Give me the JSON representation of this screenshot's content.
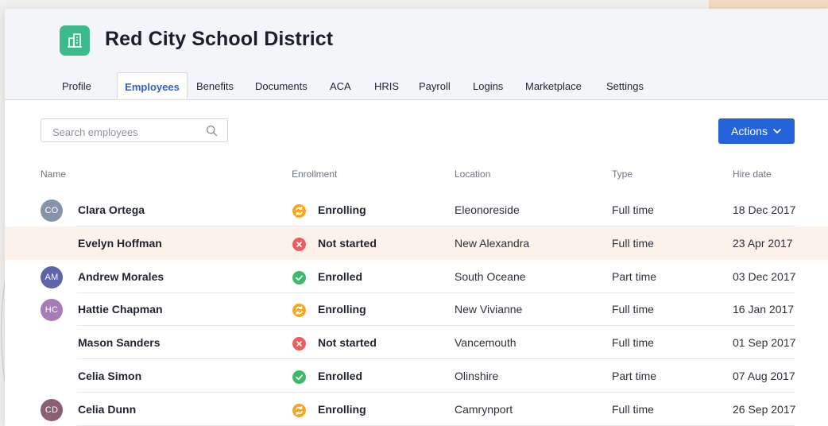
{
  "org": {
    "name": "Red City School District"
  },
  "tabs": [
    {
      "label": "Profile",
      "active": false
    },
    {
      "label": "Employees",
      "active": true
    },
    {
      "label": "Benefits",
      "active": false
    },
    {
      "label": "Documents",
      "active": false
    },
    {
      "label": "ACA",
      "active": false
    },
    {
      "label": "HRIS",
      "active": false
    },
    {
      "label": "Payroll",
      "active": false
    },
    {
      "label": "Logins",
      "active": false
    },
    {
      "label": "Marketplace",
      "active": false
    },
    {
      "label": "Settings",
      "active": false
    }
  ],
  "search": {
    "placeholder": "Search employees",
    "value": ""
  },
  "actions_button": {
    "label": "Actions"
  },
  "table": {
    "columns": [
      "Name",
      "Enrollment",
      "Location",
      "Type",
      "Hire date"
    ],
    "rows": [
      {
        "initials": "CO",
        "avatar_color": "#8594aa",
        "name": "Clara Ortega",
        "status": "Enrolling",
        "status_kind": "enrolling",
        "location": "Eleonoreside",
        "type": "Full time",
        "hire_date": "18 Dec 2017",
        "highlight": false
      },
      {
        "initials": "",
        "avatar_color": "",
        "name": "Evelyn Hoffman",
        "status": "Not started",
        "status_kind": "not-started",
        "location": "New Alexandra",
        "type": "Full time",
        "hire_date": "23 Apr 2017",
        "highlight": true
      },
      {
        "initials": "AM",
        "avatar_color": "#5e64a8",
        "name": "Andrew Morales",
        "status": "Enrolled",
        "status_kind": "enrolled",
        "location": "South Oceane",
        "type": "Part time",
        "hire_date": "03 Dec 2017",
        "highlight": false
      },
      {
        "initials": "HC",
        "avatar_color": "#a57cb6",
        "name": "Hattie Chapman",
        "status": "Enrolling",
        "status_kind": "enrolling",
        "location": "New Vivianne",
        "type": "Full time",
        "hire_date": "16 Jan 2017",
        "highlight": false
      },
      {
        "initials": "",
        "avatar_color": "",
        "name": "Mason Sanders",
        "status": "Not started",
        "status_kind": "not-started",
        "location": "Vancemouth",
        "type": "Full time",
        "hire_date": "01 Sep 2017",
        "highlight": false
      },
      {
        "initials": "",
        "avatar_color": "",
        "name": "Celia Simon",
        "status": "Enrolled",
        "status_kind": "enrolled",
        "location": "Olinshire",
        "type": "Part time",
        "hire_date": "07 Aug 2017",
        "highlight": false
      },
      {
        "initials": "CD",
        "avatar_color": "#8a5f73",
        "name": "Celia Dunn",
        "status": "Enrolling",
        "status_kind": "enrolling",
        "location": "Camrynport",
        "type": "Full time",
        "hire_date": "26 Sep 2017",
        "highlight": false
      }
    ]
  },
  "colors": {
    "accent": "#2563d9",
    "logo": "#3cba8c",
    "enrolling": "#f5a623",
    "not_started": "#ee5c5c",
    "enrolled": "#3cba6c",
    "highlight_row": "#fdf2e9"
  },
  "icons": {
    "logo": "building-icon",
    "search": "search-icon",
    "actions": "chevron-down-icon",
    "enrolling": "refresh-icon",
    "not_started": "close-icon",
    "enrolled": "check-icon"
  }
}
